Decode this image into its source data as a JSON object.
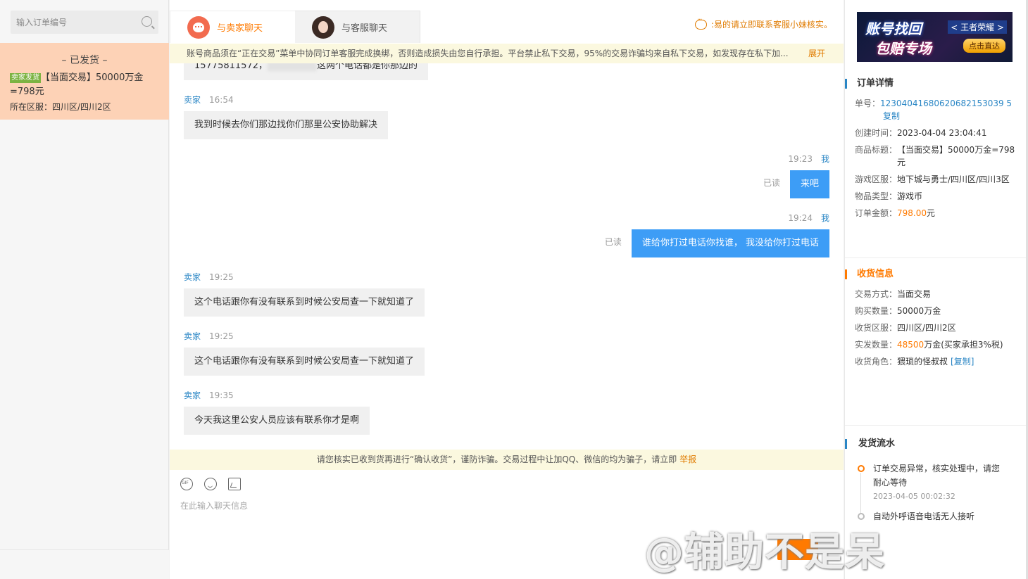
{
  "left": {
    "search_placeholder": "输入订单编号",
    "order": {
      "status": "– 已发货 –",
      "tag": "卖家发货",
      "title": "【当面交易】50000万金=798元",
      "zone": "所在区服：四川区/四川2区"
    }
  },
  "tabs": [
    {
      "label": "与卖家聊天",
      "icon": "seller-avatar-icon",
      "active": true
    },
    {
      "label": "与客服聊天",
      "icon": "service-avatar-icon",
      "active": false
    }
  ],
  "top_notice": ":易的请立即联系客服小妹核实。",
  "warn_bar": {
    "text": "账号商品须在“正在交易”菜单中协同订单客服完成换绑，否则造成损失由您自行承担。平台禁止私下交易，95%的交易诈骗均来自私下交易，如发现存在私下加...",
    "expand": "展开"
  },
  "messages": [
    {
      "side": "left",
      "partial": true,
      "text_a": "15775811572，",
      "text_b": "这两个电话都是你那边的"
    },
    {
      "side": "left",
      "who": "卖家",
      "time": "16:54",
      "text": "我到时候去你们那边找你们那里公安协助解决"
    },
    {
      "side": "right",
      "who": "我",
      "time": "19:23",
      "read": "已读",
      "text": "来吧"
    },
    {
      "side": "right",
      "who": "我",
      "time": "19:24",
      "read": "已读",
      "text": "谁给你打过电话你找谁，  我没给你打过电话"
    },
    {
      "side": "left",
      "who": "卖家",
      "time": "19:25",
      "text": "这个电话跟你有没有联系到时候公安局查一下就知道了"
    },
    {
      "side": "left",
      "who": "卖家",
      "time": "19:25",
      "text": "这个电话跟你有没有联系到时候公安局查一下就知道了"
    },
    {
      "side": "left",
      "who": "卖家",
      "time": "19:35",
      "text": "今天我这里公安人员应该有联系你才是啊"
    }
  ],
  "safe_bar": {
    "text": "请您核实已收到货再进行“确认收货”，谨防诈骗。交易过程中让加QQ、微信的均为骗子，请立即 ",
    "report": "举报"
  },
  "input": {
    "placeholder": "在此输入聊天信息"
  },
  "banner": {
    "line1": "账号找回",
    "line2": "包赔专场",
    "tag": "< 王者荣耀 >",
    "cta": "点击直达"
  },
  "order_detail": {
    "title": "订单详情",
    "order_no_label": "单号：",
    "order_no": "12304041680620682153039 5",
    "copy": "复制",
    "created_label": "创建时间：",
    "created": "2023-04-04 23:04:41",
    "product_label": "商品标题：",
    "product": "【当面交易】50000万金=798元",
    "zone_label": "游戏区服：",
    "zone": "地下城与勇士/四川区/四川3区",
    "type_label": "物品类型：",
    "type": "游戏币",
    "amount_label": "订单金额：",
    "amount": "798.00",
    "amount_unit": "元"
  },
  "receive_info": {
    "title": "收货信息",
    "method_label": "交易方式：",
    "method": "当面交易",
    "qty_label": "购买数量：",
    "qty": "50000万金",
    "zone_label": "收货区服：",
    "zone": "四川区/四川2区",
    "actual_label": "实发数量：",
    "actual_num": "48500",
    "actual_rest": "万金(买家承担3%税)",
    "role_label": "收货角色：",
    "role": "猥琐的怪叔叔",
    "copy": "[复制]"
  },
  "shipping_flow": {
    "title": "发货流水",
    "items": [
      {
        "text": "订单交易异常，核实处理中，请您耐心等待",
        "time": "2023-04-05 00:02:32"
      },
      {
        "text": "自动外呼语音电话无人接听",
        "time": ""
      }
    ]
  },
  "watermark": "@辅助不是呆"
}
